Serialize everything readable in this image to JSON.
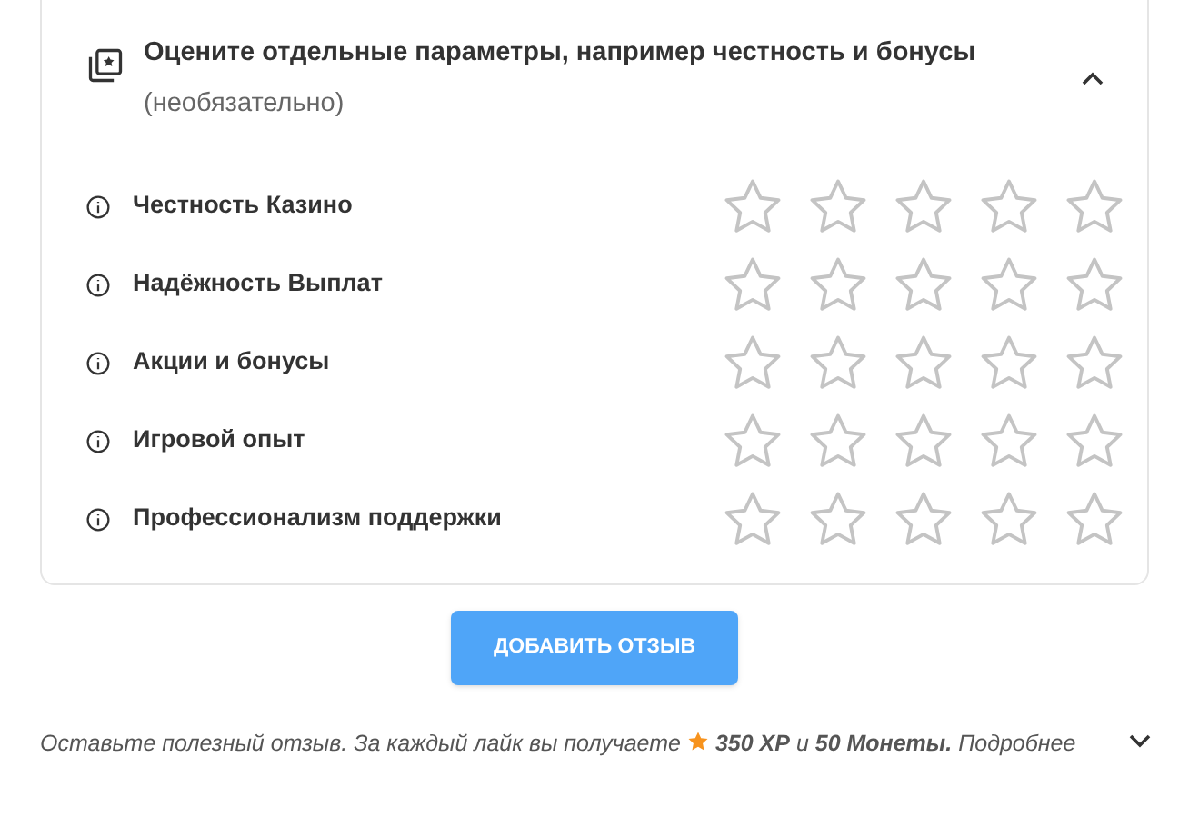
{
  "criteria_panel": {
    "title": "Оцените отдельные параметры, например честность и бонусы",
    "subtitle": "(необязательно)",
    "expanded": true,
    "criteria": [
      {
        "label": "Честность Казино",
        "stars": 0
      },
      {
        "label": "Надёжность Выплат",
        "stars": 0
      },
      {
        "label": "Акции и бонусы",
        "stars": 0
      },
      {
        "label": "Игровой опыт",
        "stars": 0
      },
      {
        "label": "Профессионализм поддержки",
        "stars": 0
      }
    ]
  },
  "submit_button": "ДОБАВИТЬ ОТЗЫВ",
  "note": {
    "before": "Оставьте полезный отзыв. За каждый лайк вы получаете",
    "after": "**350 XP**  и **50 Монеты.**",
    "more": "Подробнее",
    "expanded": false
  }
}
